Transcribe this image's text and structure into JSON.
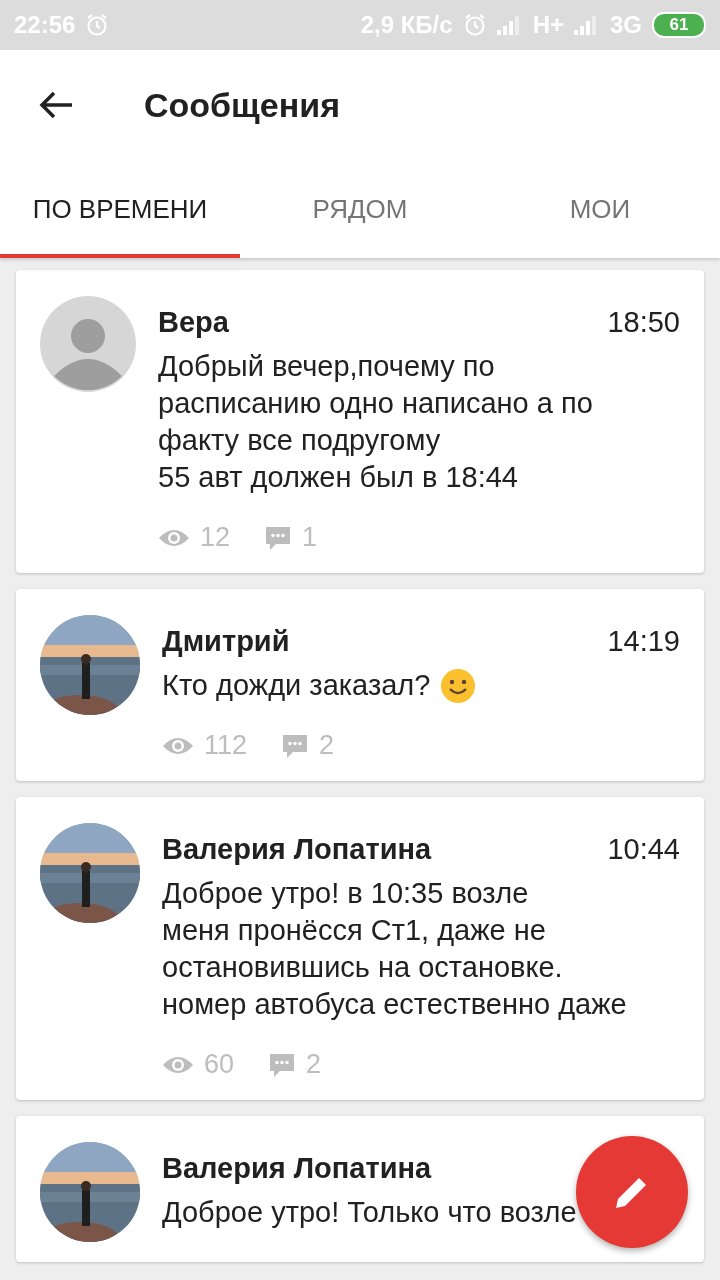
{
  "status_bar": {
    "time": "22:56",
    "speed": "2,9 КБ/с",
    "network_1": "H+",
    "network_2": "3G",
    "battery": "61"
  },
  "header": {
    "title": "Сообщения"
  },
  "tabs": [
    {
      "label": "ПО ВРЕМЕНИ",
      "selected": true
    },
    {
      "label": "РЯДОМ",
      "selected": false
    },
    {
      "label": "МОИ",
      "selected": false
    }
  ],
  "messages": [
    {
      "avatar": {
        "kind": "default"
      },
      "name": "Вера",
      "time": "18:50",
      "text": "Добрый вечер,почему по\nрасписанию одно написано а по\nфакту все подругому\n55 авт должен был в 18:44",
      "views": "12",
      "comments": "1"
    },
    {
      "name": "Дмитрий",
      "time": "14:19",
      "text": "Кто дожди заказал?",
      "emoji": true,
      "views": "112",
      "comments": "2"
    },
    {
      "name": "Валерия Лопатина",
      "time": "10:44",
      "text": "Доброе утро! в 10:35 возле\nменя пронёсся Ст1, даже не\nостановившись на остановке.\nномер автобуса естественно даже",
      "views": "60",
      "comments": "2"
    },
    {
      "name": "Валерия Лопатина",
      "text": "Доброе утро! Только что возле"
    }
  ]
}
